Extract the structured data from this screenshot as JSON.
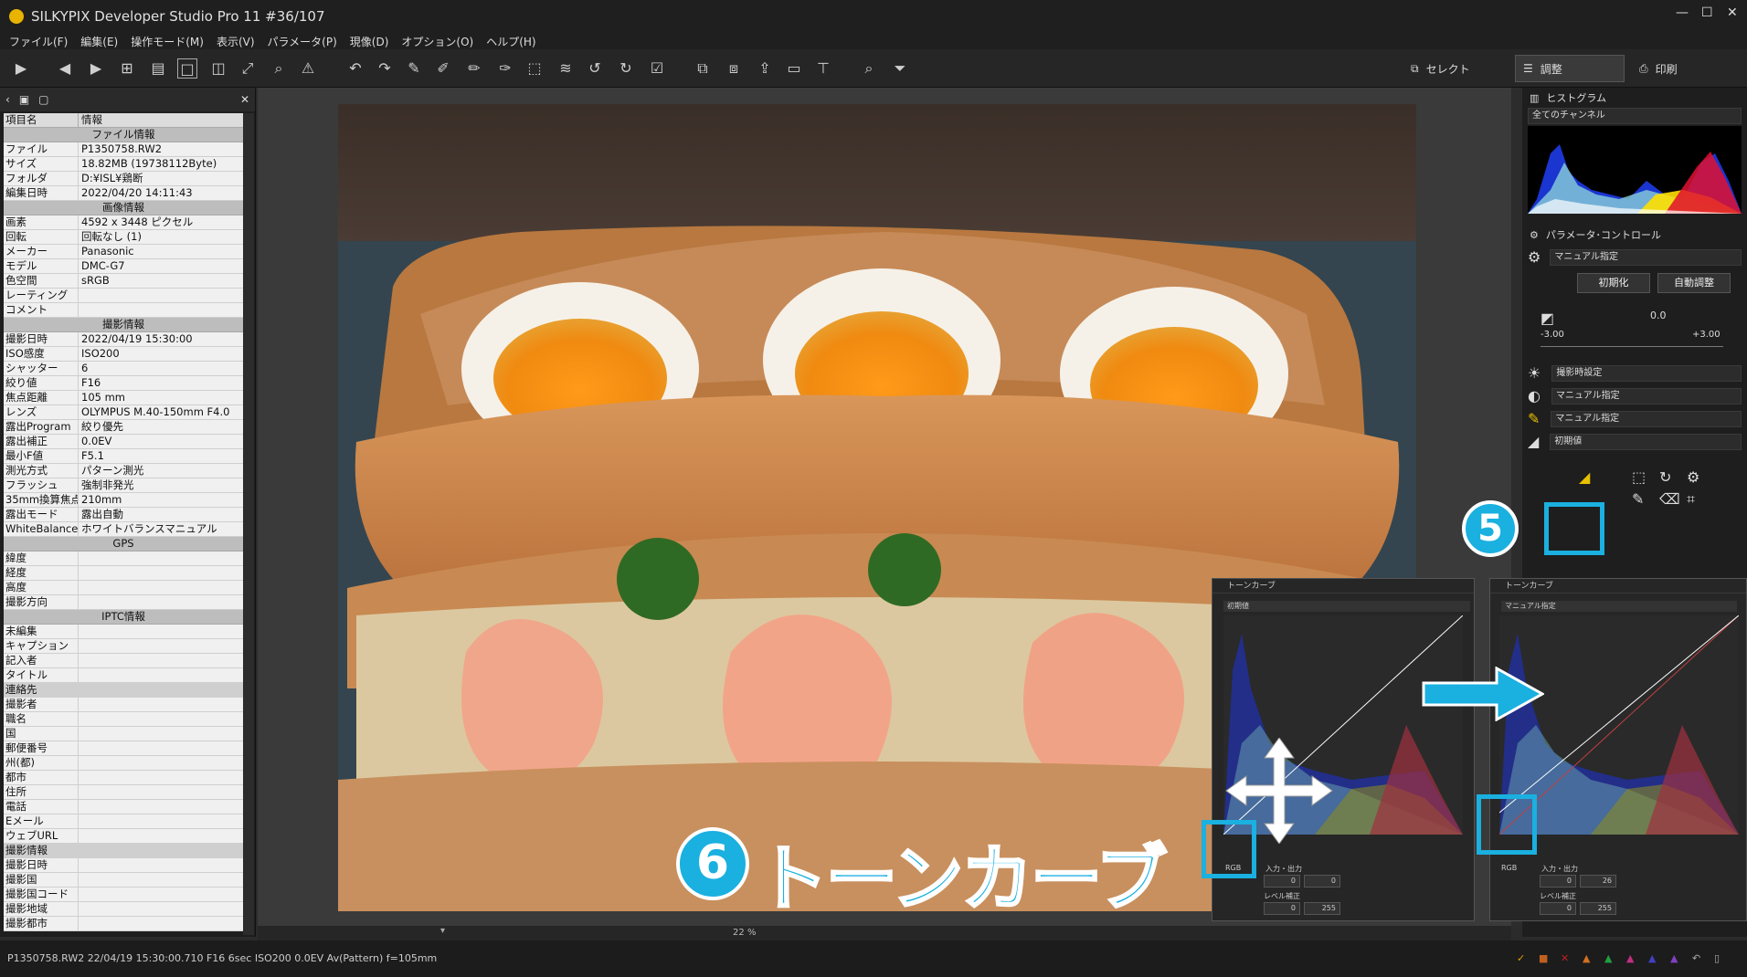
{
  "window": {
    "title": "SILKYPIX Developer Studio Pro 11   #36/107"
  },
  "menu": [
    "ファイル(F)",
    "編集(E)",
    "操作モード(M)",
    "表示(V)",
    "パラメータ(P)",
    "現像(D)",
    "オプション(O)",
    "ヘルプ(H)"
  ],
  "modes": {
    "select": "セレクト",
    "adjust": "調整",
    "print": "印刷"
  },
  "info_table": {
    "col_key": "項目名",
    "col_value": "情報",
    "rows": [
      {
        "section": "ファイル情報"
      },
      {
        "k": "ファイル",
        "v": "P1350758.RW2"
      },
      {
        "k": "サイズ",
        "v": "18.82MB (19738112Byte)"
      },
      {
        "k": "フォルダ",
        "v": "D:¥ISL¥鶏断"
      },
      {
        "k": "編集日時",
        "v": "2022/04/20 14:11:43"
      },
      {
        "section": "画像情報"
      },
      {
        "k": "画素",
        "v": "4592 x 3448 ピクセル"
      },
      {
        "k": "回転",
        "v": "回転なし (1)"
      },
      {
        "k": "メーカー",
        "v": "Panasonic"
      },
      {
        "k": "モデル",
        "v": "DMC-G7"
      },
      {
        "k": "色空間",
        "v": "sRGB"
      },
      {
        "k": "レーティング",
        "v": ""
      },
      {
        "k": "コメント",
        "v": ""
      },
      {
        "section": "撮影情報"
      },
      {
        "k": "撮影日時",
        "v": "2022/04/19 15:30:00"
      },
      {
        "k": "ISO感度",
        "v": "ISO200"
      },
      {
        "k": "シャッター",
        "v": "6"
      },
      {
        "k": "絞り値",
        "v": "F16"
      },
      {
        "k": "焦点距離",
        "v": "105 mm"
      },
      {
        "k": "レンズ",
        "v": "OLYMPUS M.40-150mm F4.0"
      },
      {
        "k": "露出Program",
        "v": "絞り優先"
      },
      {
        "k": "露出補正",
        "v": "0.0EV"
      },
      {
        "k": "最小F値",
        "v": "F5.1"
      },
      {
        "k": "測光方式",
        "v": "パターン測光"
      },
      {
        "k": "フラッシュ",
        "v": "強制非発光"
      },
      {
        "k": "35mm換算焦点",
        "v": "210mm"
      },
      {
        "k": "露出モード",
        "v": "露出自動"
      },
      {
        "k": "WhiteBalance",
        "v": "ホワイトバランスマニュアル"
      },
      {
        "section": "GPS"
      },
      {
        "k": "緯度",
        "v": ""
      },
      {
        "k": "経度",
        "v": ""
      },
      {
        "k": "高度",
        "v": ""
      },
      {
        "k": "撮影方向",
        "v": ""
      },
      {
        "section": "IPTC情報"
      },
      {
        "k": "未編集",
        "v": ""
      },
      {
        "k": "キャプション",
        "v": ""
      },
      {
        "k": "記入者",
        "v": ""
      },
      {
        "k": "タイトル",
        "v": ""
      },
      {
        "k": "連絡先",
        "v": "",
        "sub": true
      },
      {
        "k": "撮影者",
        "v": ""
      },
      {
        "k": "職名",
        "v": ""
      },
      {
        "k": "国",
        "v": ""
      },
      {
        "k": "郵便番号",
        "v": ""
      },
      {
        "k": "州(都)",
        "v": ""
      },
      {
        "k": "都市",
        "v": ""
      },
      {
        "k": "住所",
        "v": ""
      },
      {
        "k": "電話",
        "v": ""
      },
      {
        "k": "Eメール",
        "v": ""
      },
      {
        "k": "ウェブURL",
        "v": ""
      },
      {
        "k": "撮影情報",
        "v": "",
        "sub": true
      },
      {
        "k": "撮影日時",
        "v": ""
      },
      {
        "k": "撮影国",
        "v": ""
      },
      {
        "k": "撮影国コード",
        "v": ""
      },
      {
        "k": "撮影地域",
        "v": ""
      },
      {
        "k": "撮影都市",
        "v": ""
      }
    ]
  },
  "viewer": {
    "zoom": "22",
    "zoom_unit": "%"
  },
  "histogram": {
    "title": "ヒストグラム",
    "channel": "全てのチャンネル"
  },
  "param": {
    "title": "パラメータ･コントロール",
    "taste": "マニュアル指定",
    "reset": "初期化",
    "auto": "自動調整",
    "exposure_value": "0.0",
    "exposure_min": "-3.00",
    "exposure_max": "+3.00",
    "wb": "撮影時設定",
    "contrast": "マニュアル指定",
    "color": "マニュアル指定",
    "sharp": "初期値"
  },
  "tone_curve": {
    "title": "トーンカーブ",
    "left": {
      "preset": "初期値",
      "channel": "RGB",
      "io_label": "入力・出力",
      "in": "0",
      "out": "0",
      "level_label": "レベル補正",
      "level_lo": "0",
      "level_hi": "255"
    },
    "right": {
      "preset": "マニュアル指定",
      "channel": "RGB",
      "io_label": "入力・出力",
      "in": "0",
      "out": "26",
      "level_label": "レベル補正",
      "level_lo": "0",
      "level_hi": "255"
    }
  },
  "overlay": {
    "step5": "5",
    "step6_num": "6",
    "step6_label": "トーンカーブ"
  },
  "status": "P1350758.RW2 22/04/19 15:30:00.710 F16 6sec ISO200  0.0EV Av(Pattern) f=105mm"
}
